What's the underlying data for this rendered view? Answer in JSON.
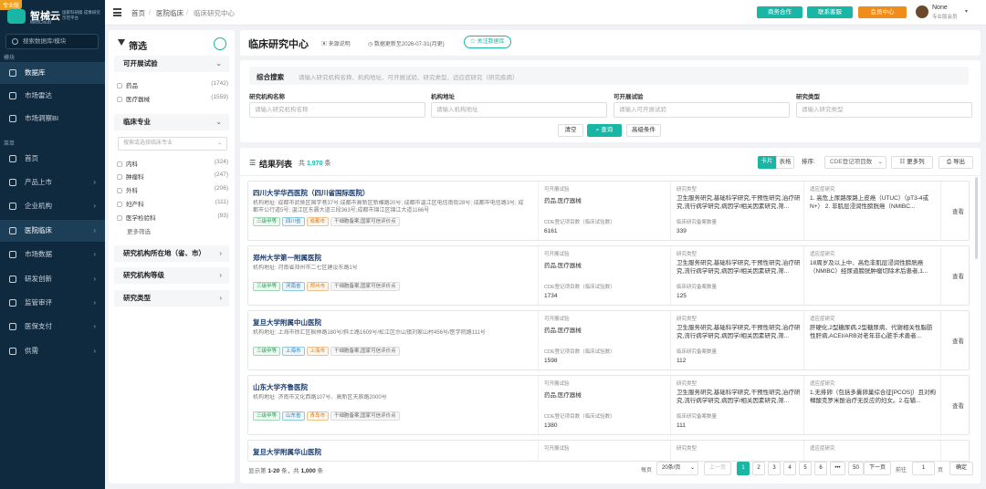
{
  "app": {
    "badge": "专业版",
    "name": "智械云",
    "name_en": "MedCloud",
    "tagline": "国家科研版 成像研究示范平台"
  },
  "sidebar": {
    "search_placeholder": "搜索数据库/模块",
    "section_module": "模块",
    "section_menu": "菜单",
    "modules": [
      {
        "label": "数据库",
        "icon": "database-icon"
      },
      {
        "label": "市场雷达",
        "icon": "radar-icon"
      },
      {
        "label": "市场洞察BI",
        "icon": "chart-icon"
      }
    ],
    "menu": [
      {
        "label": "首页",
        "icon": "home-icon"
      },
      {
        "label": "产品上市",
        "icon": "box-icon"
      },
      {
        "label": "企业机构",
        "icon": "building-icon"
      },
      {
        "label": "医院临床",
        "icon": "hospital-icon"
      },
      {
        "label": "市场数据",
        "icon": "data-icon"
      },
      {
        "label": "研发创新",
        "icon": "gear-icon"
      },
      {
        "label": "监管审评",
        "icon": "shield-icon"
      },
      {
        "label": "医保支付",
        "icon": "card-icon"
      },
      {
        "label": "供需",
        "icon": "handshake-icon"
      }
    ]
  },
  "topbar": {
    "breadcrumb": [
      "首页",
      "医院临床",
      "临床研究中心"
    ],
    "buttons": [
      "商务合作",
      "联系客服",
      "会员中心"
    ],
    "user_name": "None",
    "user_role": "专业版会员"
  },
  "filter": {
    "title": "筛选",
    "sections": [
      {
        "title": "可开展试验",
        "options": [
          {
            "label": "药品",
            "count": "(1742)"
          },
          {
            "label": "医疗器械",
            "count": "(1559)"
          }
        ]
      },
      {
        "title": "临床专业",
        "search_placeholder": "搜索或选择临床专业",
        "options": [
          {
            "label": "内科",
            "count": "(324)"
          },
          {
            "label": "肿瘤科",
            "count": "(247)"
          },
          {
            "label": "外科",
            "count": "(206)"
          },
          {
            "label": "妇产科",
            "count": "(111)"
          },
          {
            "label": "医学检验科",
            "count": "(93)"
          }
        ],
        "more": "更多筛选"
      },
      {
        "title": "研究机构所在地（省、市）"
      },
      {
        "title": "研究机构等级"
      },
      {
        "title": "研究类型"
      }
    ]
  },
  "header": {
    "title": "临床研究中心",
    "source": "来源说明",
    "updated": "数据更新至2026-07-31(月更)",
    "follow": "关注数据库"
  },
  "search": {
    "label": "综合搜索",
    "placeholder": "请输入研究机构名称、机构地址、可开展试验、研究类型、适应症研究（研究疾病）",
    "fields": [
      {
        "label": "研究机构名称",
        "placeholder": "请输入研究机构名称"
      },
      {
        "label": "机构地址",
        "placeholder": "请输入机构地址"
      },
      {
        "label": "可开展试验",
        "placeholder": "请输入可开展试验"
      },
      {
        "label": "研究类型",
        "placeholder": "请输入研究类型"
      }
    ],
    "buttons": {
      "clear": "清空",
      "query": "查询",
      "advanced": "高级条件"
    }
  },
  "results": {
    "title": "结果列表",
    "count_prefix": "共",
    "count": "1,970",
    "count_suffix": "条",
    "view_card": "卡片",
    "view_table": "表格",
    "sort_label": "排序:",
    "sort_value": "CDE登记项目数",
    "more_cols": "更多列",
    "export": "导出",
    "col_labels": {
      "trial": "可开展试验",
      "cde": "CDE登记项目数（临床试验数）",
      "type": "研究类型",
      "proj": "临床研究备案数量",
      "indication": "适应症研究"
    },
    "view_label": "查看",
    "rows": [
      {
        "name": "四川大学华西医院（四川省国际医院）",
        "address": "机构地址: 成都市武侯区国学巷37号;成都市高新区新横路20号; 成都市温江区电信南街28号; 成都市电信路3号; 成都市公行道5号; 温江区东晨大道三段363号;成都市锦江区锦江大道1166号",
        "tags": [
          [
            "三级甲等",
            "g"
          ],
          [
            "四川省",
            ""
          ],
          [
            "成都市",
            "o"
          ],
          [
            "干细胞备案,国家可信评价点",
            "gray"
          ]
        ],
        "trial": "药品,医疗器械",
        "cde": "6161",
        "type": "卫生服务研究,基础科学研究,干预性研究,治疗研究,流行病学研究,病因学/相关因素研究,筛...",
        "proj": "339",
        "indication": "1. 高危上尿路尿路上皮癌（UTUC）（pT3-4或N+） 2. 非肌层浸润性膀胱癌（NMIBC..."
      },
      {
        "name": "郑州大学第一附属医院",
        "address": "机构地址: 河南省郑州市二七区建设东路1号",
        "tags": [
          [
            "三级甲等",
            "g"
          ],
          [
            "河南省",
            ""
          ],
          [
            "郑州市",
            "o"
          ],
          [
            "干细胞备案,国家可信评价点",
            "gray"
          ]
        ],
        "trial": "药品,医疗器械",
        "cde": "1734",
        "type": "卫生服务研究,基础科学研究,干预性研究,治疗研究,流行病学研究,病因学/相关因素研究,筛...",
        "proj": "125",
        "indication": "18周岁及以上中、高危非肌层浸润性膀胱癌（NMIBC）经尿道膀胱肿瘤切除术后患者,1..."
      },
      {
        "name": "复旦大学附属中山医院",
        "address": "机构地址: 上海市徐汇区枫林路180号/斜土路1609号/松江区佘山镇刘家山村456号/医学院路111号",
        "tags": [
          [
            "三级甲等",
            "g"
          ],
          [
            "上海市",
            ""
          ],
          [
            "上海市",
            "o"
          ],
          [
            "干细胞备案,国家可信评价点",
            "gray"
          ]
        ],
        "trial": "药品,医疗器械",
        "cde": "1598",
        "type": "卫生服务研究,基础科学研究,干预性研究,治疗研究,流行病学研究,病因学/相关因素研究,筛...",
        "proj": "112",
        "indication": "肝硬化,2型糖尿病,2型糖尿病、代谢相关性脂肪性肝病,ACEI/ARB对老年非心脏手术患者..."
      },
      {
        "name": "山东大学齐鲁医院",
        "address": "机构地址: 济南市文化西路107号、高新区天辰路2000号",
        "tags": [
          [
            "三级甲等",
            "g"
          ],
          [
            "山东省",
            ""
          ],
          [
            "青岛市",
            "o"
          ],
          [
            "干细胞备案,国家可信评价点",
            "gray"
          ]
        ],
        "trial": "药品,医疗器械",
        "cde": "1380",
        "type": "卫生服务研究,基础科学研究,干预性研究,治疗研究,流行病学研究,病因学/相关因素研究,筛...",
        "proj": "111",
        "indication": "1.无排卵（包括多囊卵巢综合征[PCOS]）且对枸橼酸克罗米酚治疗无反应的妇女。2.在辅..."
      },
      {
        "name": "复旦大学附属华山医院",
        "address": "",
        "tags": [],
        "trial": "",
        "cde": "",
        "type": "",
        "proj": "",
        "indication": ""
      }
    ]
  },
  "pagination": {
    "info_prefix": "显示第",
    "range": "1-20",
    "info_mid": "条，共",
    "total": "1,000",
    "info_suffix": "条",
    "per_page_label": "每页",
    "per_page": "20条/页",
    "prev": "上一页",
    "pages": [
      "1",
      "2",
      "3",
      "4",
      "5",
      "6",
      "•••",
      "50"
    ],
    "current": "1",
    "next": "下一页",
    "goto_label": "前往",
    "goto_value": "1",
    "goto_unit": "页",
    "confirm": "确定"
  },
  "colors": {
    "accent": "#19b6a6",
    "sidebar_bg": "#0f2a3f",
    "member_orange": "#f08c1a"
  }
}
